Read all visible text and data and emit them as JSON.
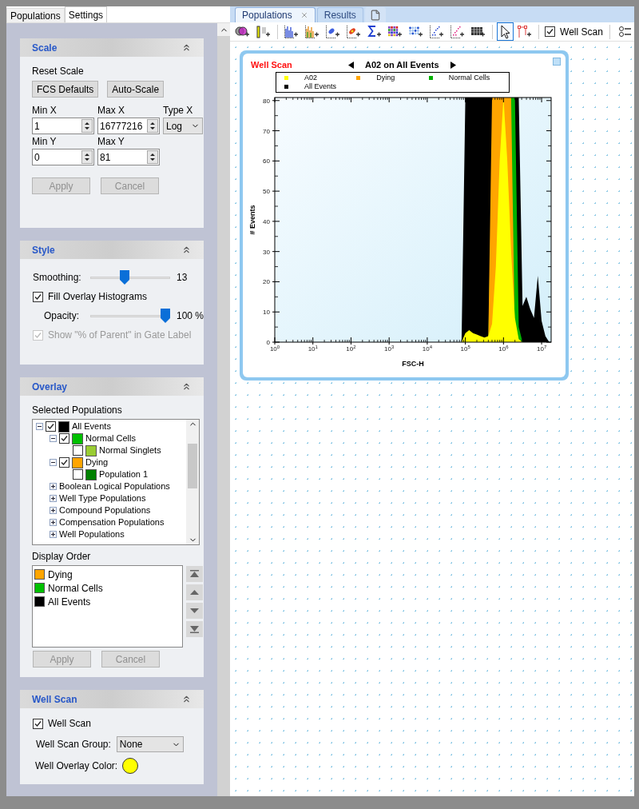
{
  "left_tabs": [
    {
      "label": "Populations",
      "selected": false
    },
    {
      "label": "Settings",
      "selected": true
    }
  ],
  "scale": {
    "title": "Scale",
    "reset_label": "Reset Scale",
    "reset_buttons": [
      "FCS Defaults",
      "Auto-Scale"
    ],
    "fields": [
      {
        "label": "Min X",
        "value": "1"
      },
      {
        "label": "Max X",
        "value": "16777216"
      },
      {
        "label": "Min Y",
        "value": "0"
      },
      {
        "label": "Max Y",
        "value": "81"
      }
    ],
    "type_x": {
      "label": "Type X",
      "value": "Log"
    },
    "actions": [
      {
        "label": "Apply",
        "disabled": true
      },
      {
        "label": "Cancel",
        "disabled": true
      }
    ]
  },
  "style": {
    "title": "Style",
    "smoothing": {
      "label": "Smoothing:",
      "level": 0.42,
      "reading": "13"
    },
    "fill_overlay": {
      "label": "Fill Overlay Histograms",
      "checked": true
    },
    "opacity": {
      "label": "Opacity:",
      "level": 1,
      "reading": "100 %"
    },
    "show_parent": {
      "label": "Show \"% of Parent\" in Gate Label",
      "checked": true,
      "disabled": true
    }
  },
  "overlay": {
    "title": "Overlay",
    "tree_label": "Selected Populations",
    "tree": [
      {
        "kind": "population",
        "label": "All Events",
        "checked": true,
        "color": "#000000",
        "expanded": true,
        "children": [
          {
            "kind": "population",
            "label": "Normal Cells",
            "checked": true,
            "color": "#00c000",
            "expanded": true,
            "children": [
              {
                "kind": "population",
                "label": "Normal Singlets",
                "checked": false,
                "color": "#99cc33"
              }
            ]
          },
          {
            "kind": "population",
            "label": "Dying",
            "checked": true,
            "color": "#ffa500",
            "expanded": true,
            "children": [
              {
                "kind": "population",
                "label": "Population 1",
                "checked": false,
                "color": "#008000"
              }
            ]
          },
          {
            "kind": "group",
            "label": "Boolean Logical Populations",
            "expanded": false
          },
          {
            "kind": "group",
            "label": "Well Type Populations",
            "expanded": false
          },
          {
            "kind": "group",
            "label": "Compound Populations",
            "expanded": false
          },
          {
            "kind": "group",
            "label": "Compensation Populations",
            "expanded": false
          },
          {
            "kind": "group",
            "label": "Well Populations",
            "expanded": false
          }
        ]
      }
    ],
    "order_label": "Display Order",
    "order": [
      {
        "label": "Dying",
        "color": "#ffa500"
      },
      {
        "label": "Normal Cells",
        "color": "#00c000"
      },
      {
        "label": "All Events",
        "color": "#000000"
      }
    ],
    "actions": [
      {
        "label": "Apply",
        "disabled": true
      },
      {
        "label": "Cancel",
        "disabled": true
      }
    ]
  },
  "well_scan": {
    "title": "Well Scan",
    "enabled": {
      "label": "Well Scan",
      "checked": true
    },
    "group": {
      "label": "Well Scan Group:",
      "value": "None"
    },
    "color_label": "Well Overlay Color:",
    "color": "#ffff00"
  },
  "doc_tabs": [
    {
      "label": "Populations",
      "selected": true,
      "closable": true
    },
    {
      "label": "Results",
      "selected": false,
      "closable": false
    }
  ],
  "toolbar": {
    "groups": [
      [
        {
          "kind": "venn",
          "selected": false
        },
        {
          "kind": "gate-bar",
          "selected": false
        }
      ],
      [
        {
          "kind": "histogram",
          "selected": false
        },
        {
          "kind": "histogram-color",
          "selected": false
        },
        {
          "kind": "scatter",
          "selected": false
        },
        {
          "kind": "density",
          "selected": false
        },
        {
          "kind": "sigma",
          "selected": false
        },
        {
          "kind": "heatmap",
          "selected": false
        },
        {
          "kind": "dots",
          "selected": false
        },
        {
          "kind": "scatter-blue",
          "selected": false
        },
        {
          "kind": "scatter-pink",
          "selected": false
        },
        {
          "kind": "table",
          "selected": false
        }
      ],
      [
        {
          "kind": "pointer",
          "selected": true
        },
        {
          "kind": "gate",
          "selected": false
        }
      ]
    ],
    "well_scan": {
      "label": "Well Scan",
      "checked": true
    },
    "trailing": [
      {
        "kind": "list",
        "selected": false
      }
    ]
  },
  "plot": {
    "title": "Well Scan",
    "subtitle": "A02 on All Events",
    "legend": [
      {
        "name": "A02",
        "color": "#ffff00"
      },
      {
        "name": "Dying",
        "color": "#ffa500"
      },
      {
        "name": "Normal Cells",
        "color": "#00b000"
      },
      {
        "name": "All Events",
        "color": "#000000"
      }
    ],
    "x_axis_title": "FSC-H",
    "y_axis_title": "# Events",
    "x_tick_labels": [
      "10$^{0}$",
      "10$^{1}$",
      "10$^{2}$",
      "10$^{3}$",
      "10$^{4}$",
      "10$^{5}$",
      "10$^{6}$",
      "10$^{7}$"
    ],
    "y_tick_labels": [
      "80",
      "70",
      "60",
      "50",
      "40",
      "30",
      "20",
      "10",
      "0"
    ]
  }
}
